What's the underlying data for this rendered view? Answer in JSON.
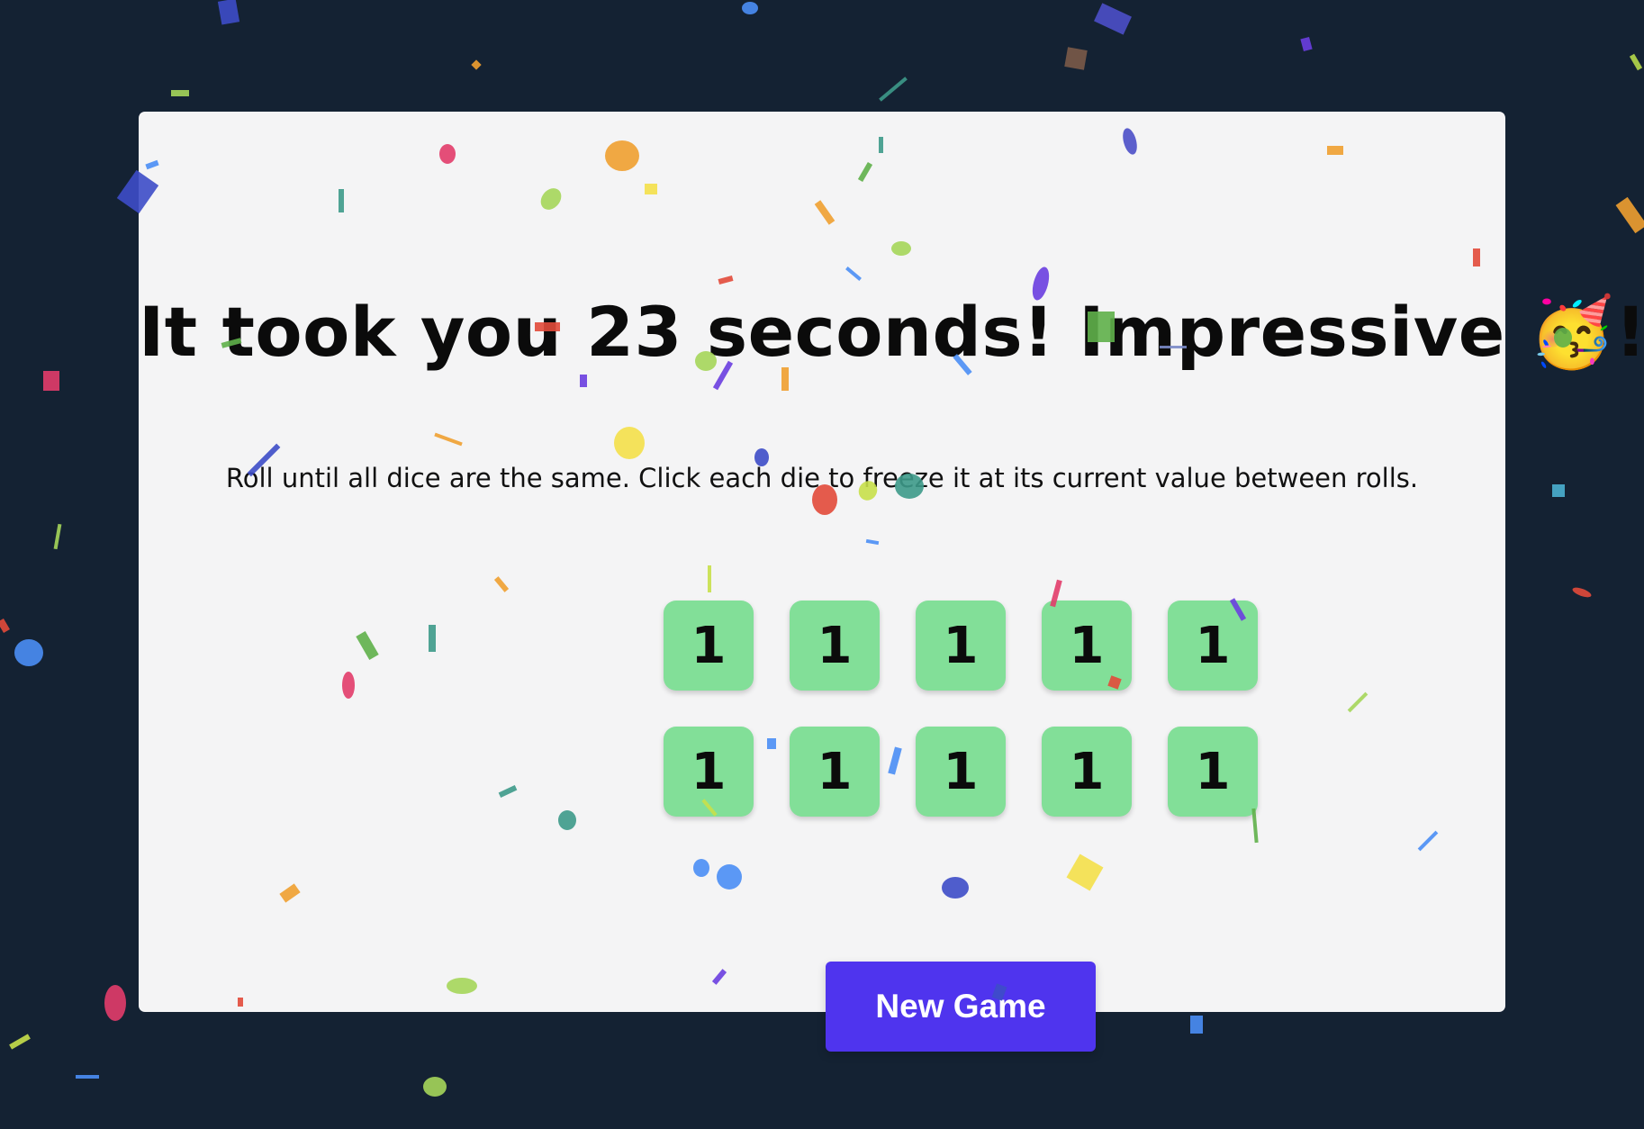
{
  "game": {
    "title": "It took you 23 seconds! Impressive 🥳!",
    "instructions": "Roll until all dice are the same. Click each die to freeze it at its current value between rolls.",
    "dice": [
      "1",
      "1",
      "1",
      "1",
      "1",
      "1",
      "1",
      "1",
      "1",
      "1"
    ],
    "new_game_label": "New Game"
  },
  "colors": {
    "background": "#142233",
    "card": "#f4f4f5",
    "die_held": "#82df98",
    "button": "#4f34ee"
  }
}
